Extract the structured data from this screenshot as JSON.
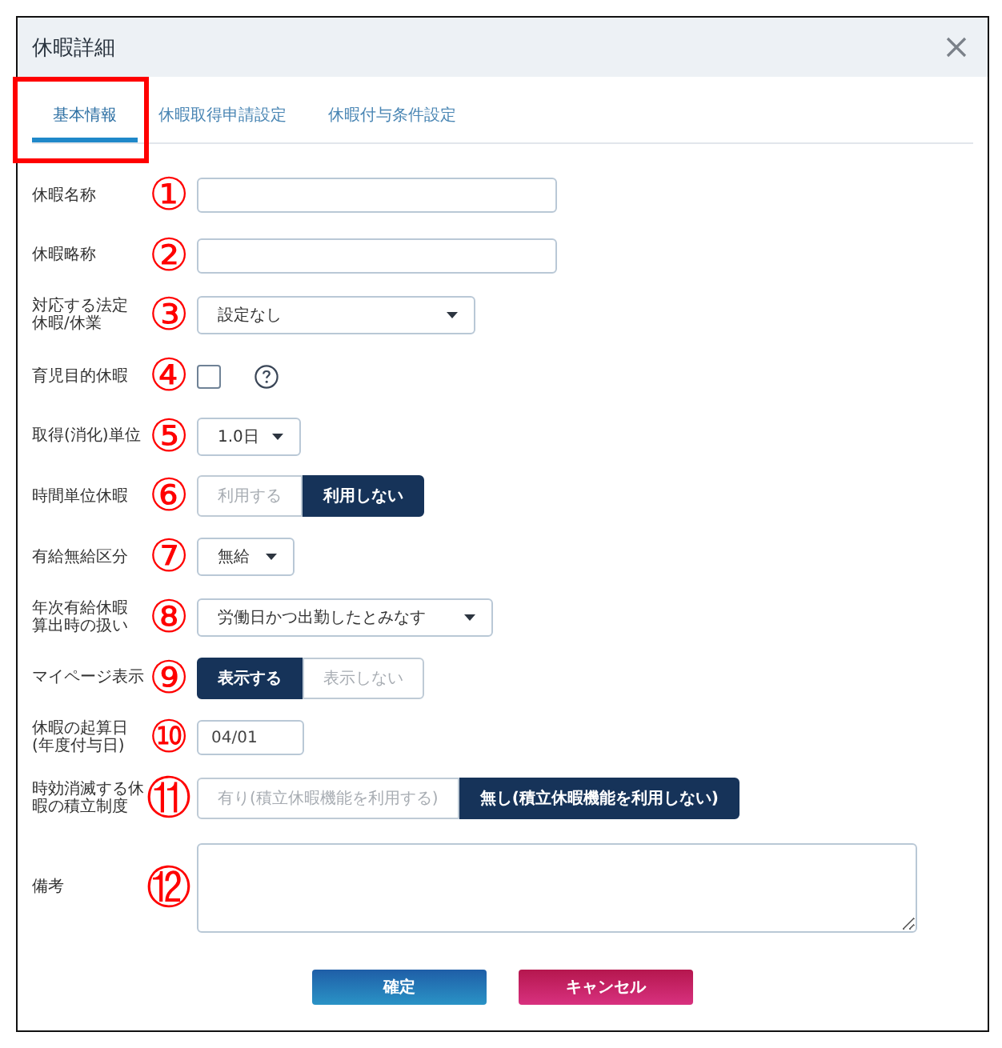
{
  "window": {
    "title": "休暇詳細"
  },
  "tabs": [
    {
      "label": "基本情報",
      "selected": true,
      "highlighted": true
    },
    {
      "label": "休暇取得申請設定",
      "selected": false,
      "highlighted": false
    },
    {
      "label": "休暇付与条件設定",
      "selected": false,
      "highlighted": false
    }
  ],
  "fields": [
    {
      "kind": "text",
      "label": "休暇名称",
      "marker": "①"
    },
    {
      "kind": "text",
      "label": "休暇略称",
      "marker": "②"
    },
    {
      "kind": "select",
      "label": "対応する法定休暇/休業",
      "marker": "③",
      "value": "設定なし"
    },
    {
      "kind": "checkbox",
      "label": "育児目的休暇",
      "marker": "④",
      "checked": false,
      "help": true
    },
    {
      "kind": "select",
      "label": "取得(消化)単位",
      "marker": "⑤",
      "value": "1.0日"
    },
    {
      "kind": "toggle",
      "label": "時間単位休暇",
      "marker": "⑥",
      "options": [
        {
          "label": "利用する",
          "selected": false
        },
        {
          "label": "利用しない",
          "selected": true
        }
      ]
    },
    {
      "kind": "select",
      "label": "有給無給区分",
      "marker": "⑦",
      "value": "無給"
    },
    {
      "kind": "select",
      "label": "年次有給休暇算出時の扱い",
      "marker": "⑧",
      "value": "労働日かつ出勤したとみなす"
    },
    {
      "kind": "toggle",
      "label": "マイページ表示",
      "marker": "⑨",
      "options": [
        {
          "label": "表示する",
          "selected": true
        },
        {
          "label": "表示しない",
          "selected": false
        }
      ]
    },
    {
      "kind": "text",
      "label": "休暇の起算日(年度付与日)",
      "marker": "⑩",
      "value": "04/01"
    },
    {
      "kind": "toggle",
      "label": "時効消滅する休暇の積立制度",
      "marker": "⑪",
      "options": [
        {
          "label": "有り(積立休暇機能を利用する)",
          "selected": false
        },
        {
          "label": "無し(積立休暇機能を利用しない)",
          "selected": true
        }
      ]
    },
    {
      "kind": "textarea",
      "label": "備考",
      "marker": "⑫"
    }
  ],
  "buttons": [
    {
      "label": "確定",
      "kind": "primary"
    },
    {
      "label": "キャンセル",
      "kind": "cancel"
    }
  ]
}
